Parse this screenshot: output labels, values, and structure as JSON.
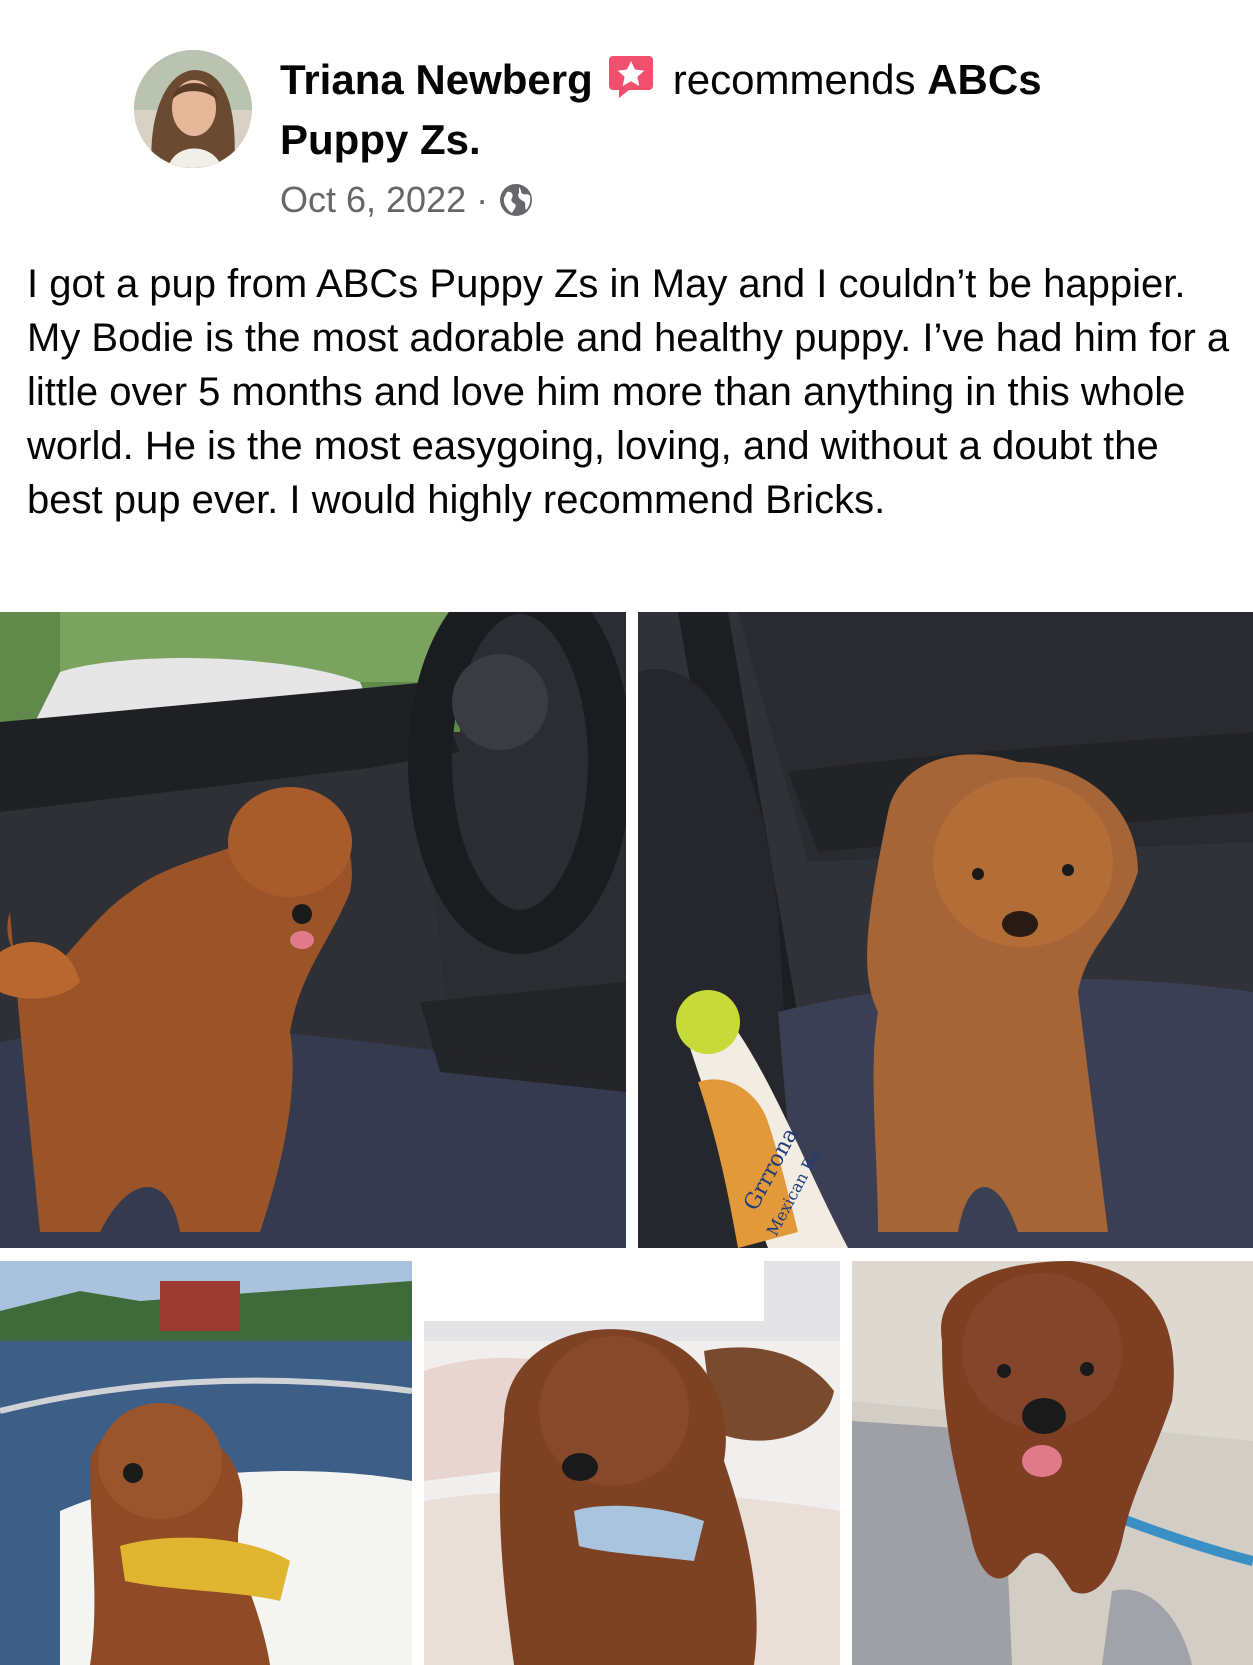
{
  "post": {
    "author_name": "Triana Newberg",
    "recommends_label": "recommends",
    "page_name_line1": "ABCs",
    "page_name_line2": "Puppy Zs.",
    "date": "Oct 6, 2022",
    "separator": "·",
    "privacy_icon": "globe-icon",
    "recommendation_icon": "star-badge-icon",
    "text": "I got a pup from ABCs Puppy Zs in May and I couldn’t be happier. My Bodie is the most adorable and healthy puppy. I’ve had him for a little over 5 months and love him more than anything in this whole world. He is the most easygoing, loving, and without a doubt the best pup ever. I would highly recommend Bricks."
  },
  "photos": {
    "count": 5,
    "toy_label_1": "Grrrona",
    "toy_label_2": "Mexican Be"
  },
  "colors": {
    "recommend_badge": "#f0506e",
    "meta_gray": "#65676b",
    "text": "#050505"
  }
}
